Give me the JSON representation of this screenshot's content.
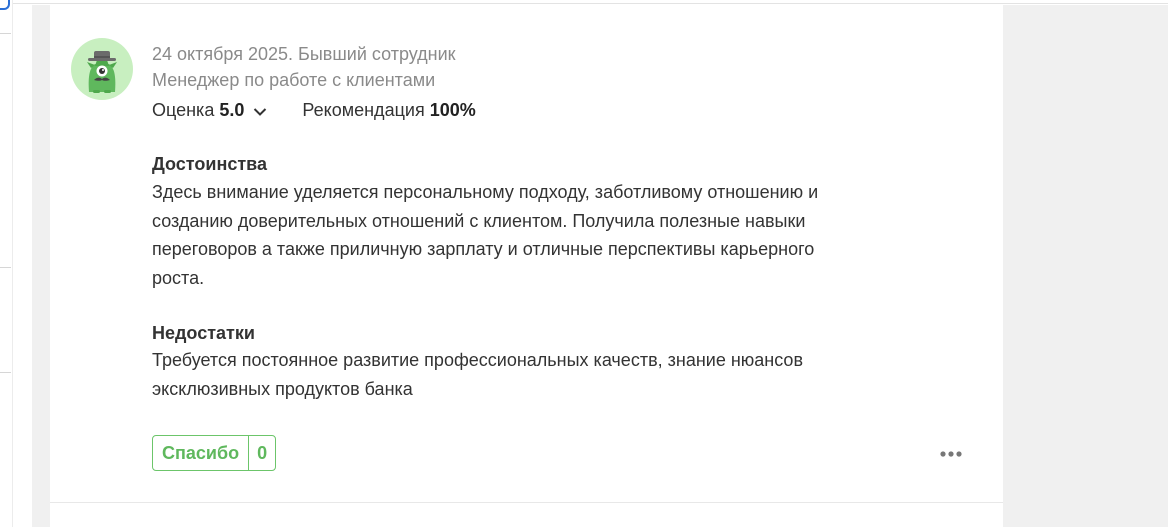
{
  "review": {
    "date_status": "24 октября 2025. Бывший сотрудник",
    "position": "Менеджер по работе с клиентами",
    "rating_label": "Оценка",
    "rating_value": "5.0",
    "recommend_label": "Рекомендация",
    "recommend_value": "100%",
    "pros_title": "Достоинства",
    "pros_text": "Здесь внимание уделяется персональному подходу, заботливому отношению и созданию доверительных отношений с клиентом. Получила полезные навыки переговоров а также приличную зарплату и отличные перспективы карьерного роста.",
    "cons_title": "Недостатки",
    "cons_text": "Требуется постоянное развитие профессиональных качеств, знание нюансов эксклюзивных продуктов банка",
    "thanks_label": "Спасибо",
    "thanks_count": "0"
  },
  "colors": {
    "accent_green": "#5fb85d",
    "avatar_bg": "#c8efc0",
    "muted_text": "#8a8a8a",
    "page_gray": "#f0f0f0"
  },
  "icons": {
    "avatar": "anonymous-owl-avatar-icon",
    "rating_toggle": "chevron-down-icon",
    "more": "more-dots-icon"
  }
}
